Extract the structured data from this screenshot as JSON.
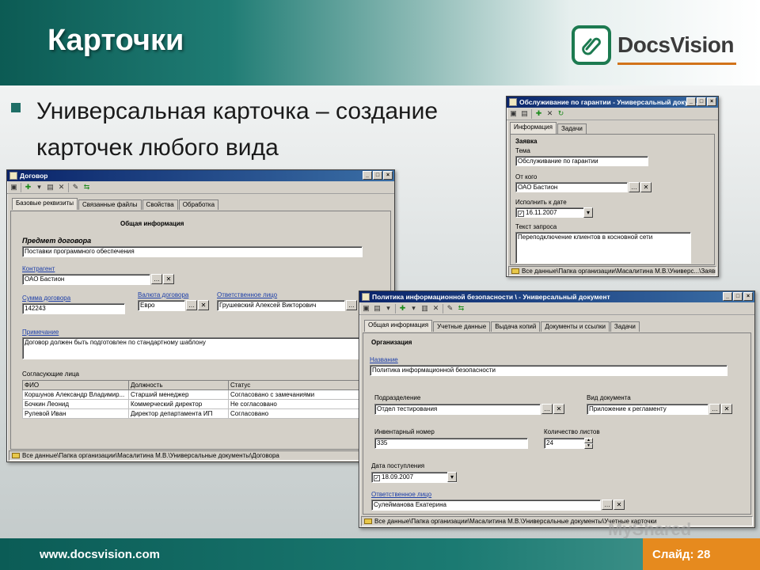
{
  "slide": {
    "title": "Карточки",
    "bullet": "Универсальная карточка – создание карточек любого вида",
    "logo_text": "DocsVision",
    "footer_url": "www.docsvision.com",
    "slide_label": "Слайд: 28",
    "watermark": "MyShared",
    "colors": {
      "header": "#0c5b54",
      "footer_accent": "#e68a1e",
      "bullet": "#1e6e66"
    }
  },
  "win_warranty": {
    "title": "Обслуживание по гарантии - Универсальный докум...",
    "tabs": [
      "Информация",
      "Задачи"
    ],
    "section": "Заявка",
    "theme_label": "Тема",
    "theme_value": "Обслуживание по гарантии",
    "from_label": "От кого",
    "from_value": "ОАО Бастион",
    "due_label": "Исполнить к дате",
    "due_value": "16.11.2007",
    "request_label": "Текст запроса",
    "request_value": "Переподключение клиентов в косновной сети",
    "status": "Все данные\\Папка организации\\Масалитина М.В.\\Универс...\\Заявки"
  },
  "win_contract": {
    "title": "Договор",
    "tabs": [
      "Базовые реквизиты",
      "Связанные файлы",
      "Свойства",
      "Обработка"
    ],
    "section": "Общая информация",
    "subject_label": "Предмет договора",
    "subject_value": "Поставки программного обеспечения",
    "counterparty_label": "Контрагент",
    "counterparty_value": "ОАО Бастион",
    "amount_label": "Сумма договора",
    "amount_value": "142243",
    "currency_label": "Валюта договора",
    "currency_value": "Евро",
    "responsible_label": "Ответственное лицо",
    "responsible_value": "Грушевский Алексей Викторович",
    "note_label": "Примечание",
    "note_value": "Договор должен быть подготовлен по стандартному шаблону",
    "approvers_label": "Согласующие лица",
    "columns": [
      "ФИО",
      "Должность",
      "Статус"
    ],
    "rows": [
      [
        "Коршунов Александр Владимир...",
        "Старший менеджер",
        "Согласовано с замечаниями"
      ],
      [
        "Бочкин Леонид",
        "Коммерческий директор",
        "Не согласовано"
      ],
      [
        "Рулевой Иван",
        "Директор департамента ИП",
        "Согласовано"
      ]
    ],
    "status": "Все данные\\Папка организации\\Масалитина М.В.\\Универсальные документы\\Договора"
  },
  "win_policy": {
    "title": "Политика информационной безопасности \\ - Универсальный документ",
    "tabs": [
      "Общая информация",
      "Учетные данные",
      "Выдача копий",
      "Документы и ссылки",
      "Задачи"
    ],
    "section": "Организация",
    "name_label": "Название",
    "name_value": "Политика информационной безопасности",
    "division_label": "Подразделение",
    "division_value": "Отдел тестирования",
    "doctype_label": "Вид документа",
    "doctype_value": "Приложение к регламенту",
    "inv_label": "Инвентарный номер",
    "inv_value": "335",
    "sheets_label": "Количество листов",
    "sheets_value": "24",
    "date_label": "Дата поступления",
    "date_value": "18.09.2007",
    "resp_label": "Ответственное лицо",
    "resp_value": "Сулейманова Екатерина",
    "status": "Все данные\\Папка организации\\Масалитина М.В.\\Универсальные документы\\Учетные карточки"
  }
}
